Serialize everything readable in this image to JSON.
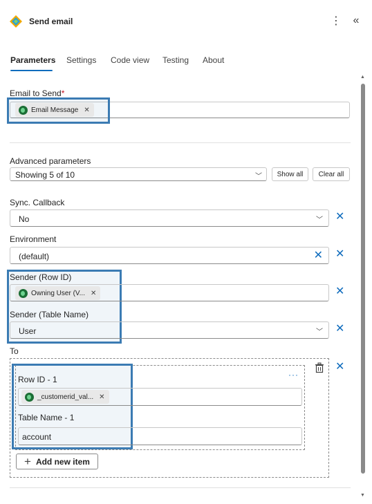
{
  "header": {
    "title": "Send email",
    "more_icon": "⋮",
    "collapse_icon": "«"
  },
  "tabs": [
    {
      "label": "Parameters",
      "active": true
    },
    {
      "label": "Settings",
      "active": false
    },
    {
      "label": "Code view",
      "active": false
    },
    {
      "label": "Testing",
      "active": false
    },
    {
      "label": "About",
      "active": false
    }
  ],
  "email_to_send": {
    "label": "Email to Send",
    "required_mark": "*",
    "chip_label": "Email Message"
  },
  "advanced": {
    "label": "Advanced parameters",
    "value": "Showing 5 of 10",
    "show_all": "Show all",
    "clear_all": "Clear all"
  },
  "sync_callback": {
    "label": "Sync. Callback",
    "value": "No"
  },
  "environment": {
    "label": "Environment",
    "value": "(default)"
  },
  "sender_row_id": {
    "label": "Sender (Row ID)",
    "chip_label": "Owning User (V..."
  },
  "sender_table_name": {
    "label": "Sender (Table Name)",
    "value": "User"
  },
  "to": {
    "label": "To",
    "more": "···",
    "row_id_label": "Row ID - 1",
    "row_id_chip": "_customerid_val...",
    "table_name_label": "Table Name - 1",
    "table_name_value": "account",
    "add_new_item": "Add new item"
  },
  "colors": {
    "accent": "#0f6cbd",
    "highlight_border": "#3b7bb3"
  }
}
